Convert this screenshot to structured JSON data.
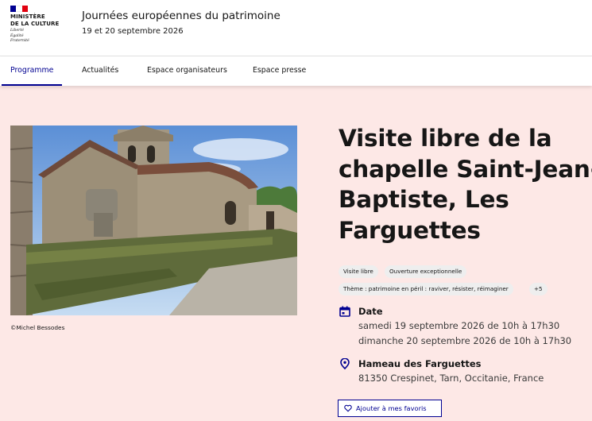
{
  "brand": {
    "logo_lines": [
      "MINISTÈRE",
      "DE LA CULTURE"
    ],
    "motto_lines": [
      "Liberté",
      "Égalité",
      "Fraternité"
    ],
    "flag_colors": [
      "#000091",
      "#ffffff",
      "#e1000f"
    ]
  },
  "header": {
    "title": "Journées européennes du patrimoine",
    "subtitle": "19 et 20 septembre 2026"
  },
  "nav": {
    "items": [
      {
        "label": "Programme",
        "active": true
      },
      {
        "label": "Actualités",
        "active": false
      },
      {
        "label": "Espace organisateurs",
        "active": false
      },
      {
        "label": "Espace presse",
        "active": false
      }
    ]
  },
  "event": {
    "photo_credit": "©Michel Bessodes",
    "title": "Visite libre de la chapelle Saint-Jean-Baptiste, Les Farguettes",
    "tags": [
      "Visite libre",
      "Ouverture exceptionnelle",
      "Thème : patrimoine en péril : raviver, résister, réimaginer",
      "+5"
    ],
    "date_label": "Date",
    "dates": [
      "samedi 19 septembre 2026 de 10h à 17h30",
      "dimanche 20 septembre 2026 de 10h à 17h30"
    ],
    "place_name": "Hameau des Farguettes",
    "address": "81350 Crespinet, Tarn, Occitanie, France",
    "favorite_label": "Ajouter à mes favoris"
  },
  "colors": {
    "accent": "#000091",
    "background": "#fde8e6",
    "tag_bg": "#eeeeee"
  },
  "icons": {
    "date": "calendar-icon",
    "place": "map-pin-icon",
    "favorite": "heart-icon"
  }
}
